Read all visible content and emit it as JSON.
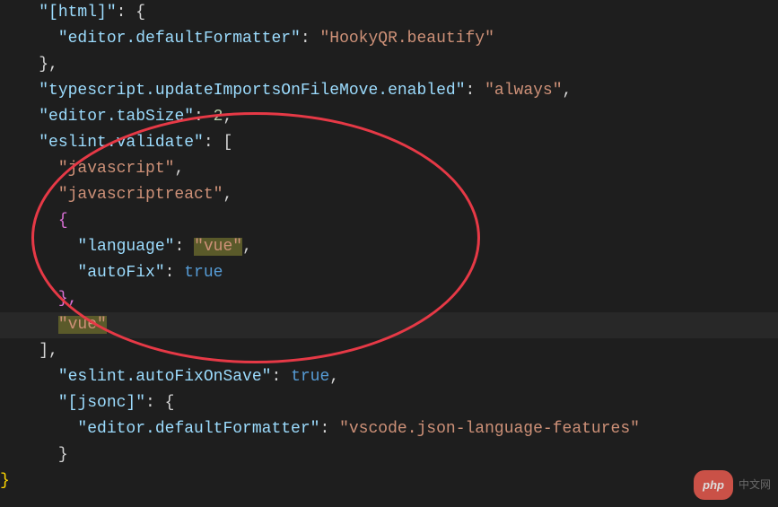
{
  "code": {
    "line1_key": "\"[html]\"",
    "line1_brace": ": {",
    "line2_key": "\"editor.defaultFormatter\"",
    "line2_val": "\"HookyQR.beautify\"",
    "line3": "},",
    "line4_key": "\"typescript.updateImportsOnFileMove.enabled\"",
    "line4_val": "\"always\"",
    "line5_key": "\"editor.tabSize\"",
    "line5_val": "2",
    "line6_key": "\"eslint.validate\"",
    "line6_brace": ": [",
    "line7_val": "\"javascript\"",
    "line8_val": "\"javascriptreact\"",
    "line9": "{",
    "line10_key": "\"language\"",
    "line10_val": "\"vue\"",
    "line11_key": "\"autoFix\"",
    "line11_val": "true",
    "line12": "},",
    "line13_val": "\"vue\"",
    "line14": "],",
    "line15_key": "\"eslint.autoFixOnSave\"",
    "line15_val": "true",
    "line16_key": "\"[jsonc]\"",
    "line16_brace": ": {",
    "line17_key": "\"editor.defaultFormatter\"",
    "line17_val": "\"vscode.json-language-features\"",
    "line18": "}",
    "line19": "}"
  },
  "watermark": {
    "pill": "php",
    "text": "中文网"
  }
}
